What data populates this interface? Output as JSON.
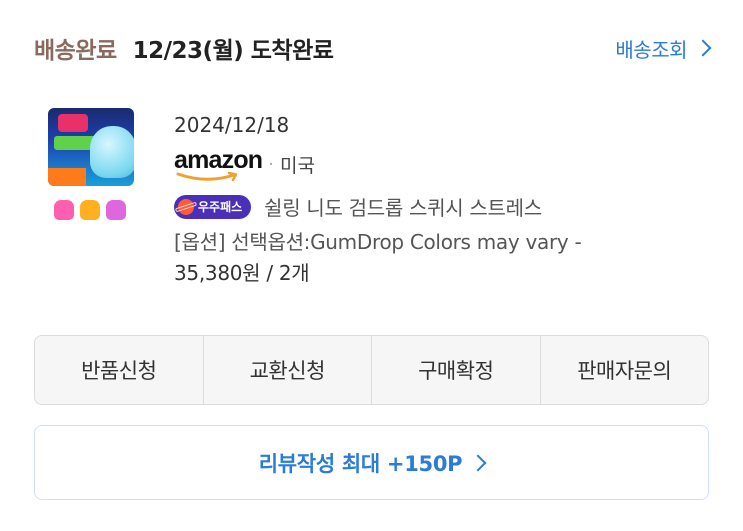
{
  "header": {
    "status": "배송완료",
    "arrival": "12/23(월) 도착완료",
    "track_label": "배송조회"
  },
  "order": {
    "date": "2024/12/18",
    "seller_logo_text": "amazon",
    "separator": "·",
    "country": "미국",
    "badge_label": "우주패스",
    "product_name": "쉴링 니도 검드롭 스퀴시 스트레스",
    "option": "[옵션] 선택옵션:GumDrop Colors may vary -",
    "price": "35,380원 / 2개"
  },
  "actions": [
    {
      "label": "반품신청"
    },
    {
      "label": "교환신청"
    },
    {
      "label": "구매확정"
    },
    {
      "label": "판매자문의"
    }
  ],
  "review": {
    "label": "리뷰작성 최대 +150P"
  },
  "colors": {
    "status": "#8a6a5e",
    "accent": "#2a7cd6",
    "badge": "#4a2fb8",
    "dot_colors": [
      "#ff5fae",
      "#ffb020",
      "#e066e0"
    ]
  }
}
